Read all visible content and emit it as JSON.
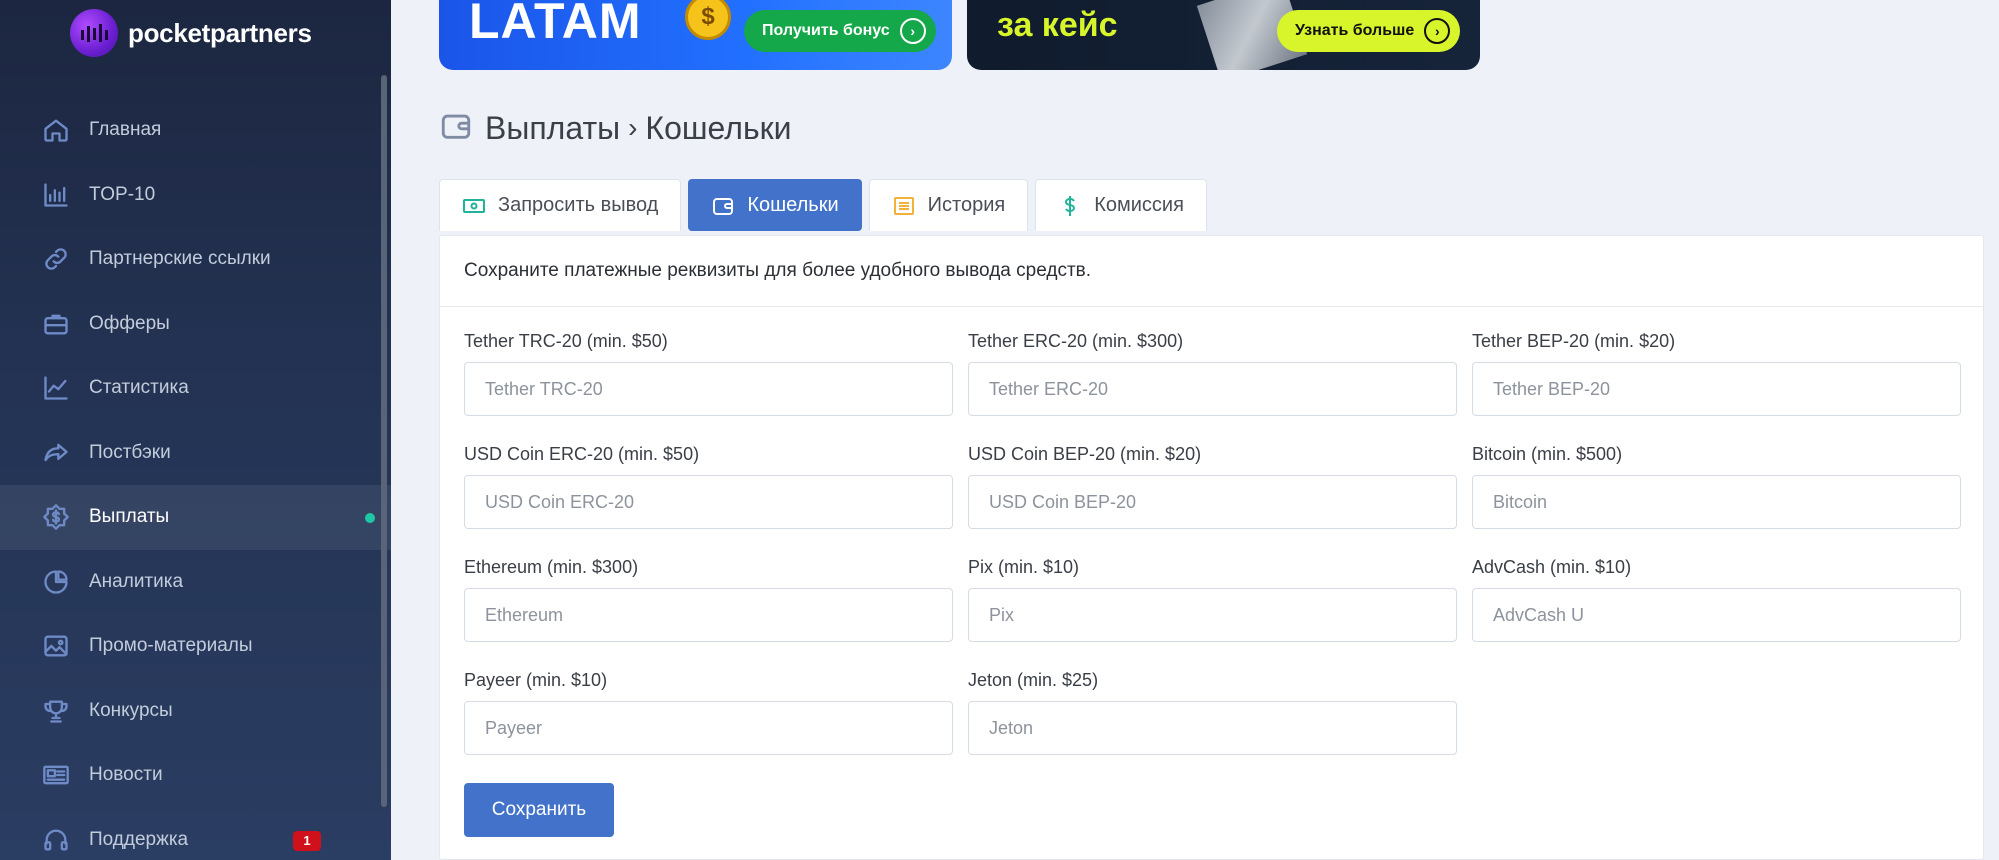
{
  "brand": {
    "name": "pocketpartners"
  },
  "sidebar": {
    "items": [
      {
        "label": "Главная",
        "icon": "home-icon"
      },
      {
        "label": "TOP-10",
        "icon": "bar-chart-icon"
      },
      {
        "label": "Партнерские ссылки",
        "icon": "link-icon"
      },
      {
        "label": "Офферы",
        "icon": "briefcase-icon"
      },
      {
        "label": "Статистика",
        "icon": "line-chart-icon"
      },
      {
        "label": "Постбэки",
        "icon": "share-arrow-icon"
      },
      {
        "label": "Выплаты",
        "icon": "dollar-circle-icon",
        "active": true
      },
      {
        "label": "Аналитика",
        "icon": "pie-chart-icon"
      },
      {
        "label": "Промо-материалы",
        "icon": "image-icon"
      },
      {
        "label": "Конкурсы",
        "icon": "trophy-icon"
      },
      {
        "label": "Новости",
        "icon": "newspaper-icon"
      },
      {
        "label": "Поддержка",
        "icon": "headset-icon",
        "badge": "1"
      }
    ]
  },
  "banners": {
    "left": {
      "headline": "LATAM",
      "button": "Получить бонус",
      "coin": "$"
    },
    "right": {
      "headline": "за кейс",
      "button": "Узнать больше"
    }
  },
  "heading": {
    "section": "Выплаты",
    "page": "Кошельки"
  },
  "tabs": [
    {
      "label": "Запросить вывод",
      "icon": "cash-icon"
    },
    {
      "label": "Кошельки",
      "icon": "wallet-icon",
      "active": true
    },
    {
      "label": "История",
      "icon": "list-icon"
    },
    {
      "label": "Комиссия",
      "icon": "dollar-icon"
    }
  ],
  "card": {
    "note": "Сохраните платежные реквизиты для более удобного вывода средств.",
    "fields": [
      {
        "label": "Tether TRC-20 (min. $50)",
        "placeholder": "Tether TRC-20"
      },
      {
        "label": "Tether ERC-20 (min. $300)",
        "placeholder": "Tether ERC-20"
      },
      {
        "label": "Tether BEP-20 (min. $20)",
        "placeholder": "Tether BEP-20"
      },
      {
        "label": "USD Coin ERC-20 (min. $50)",
        "placeholder": "USD Coin ERC-20"
      },
      {
        "label": "USD Coin BEP-20 (min. $20)",
        "placeholder": "USD Coin BEP-20"
      },
      {
        "label": "Bitcoin (min. $500)",
        "placeholder": "Bitcoin"
      },
      {
        "label": "Ethereum (min. $300)",
        "placeholder": "Ethereum"
      },
      {
        "label": "Pix (min. $10)",
        "placeholder": "Pix"
      },
      {
        "label": "AdvCash (min. $10)",
        "placeholder": "AdvCash U"
      },
      {
        "label": "Payeer (min. $10)",
        "placeholder": "Payeer"
      },
      {
        "label": "Jeton (min. $25)",
        "placeholder": "Jeton"
      }
    ],
    "save_label": "Сохранить"
  },
  "colors": {
    "accent": "#4272c9",
    "sidebar": "#233252",
    "active_dot": "#1fc8a5",
    "badge": "#d0101a"
  }
}
